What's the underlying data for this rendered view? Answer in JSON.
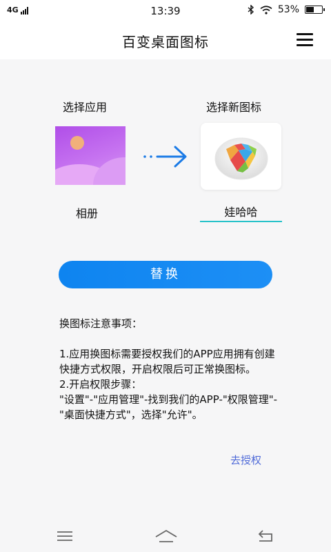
{
  "status": {
    "network": "4G",
    "time": "13:39",
    "battery_text": "53%",
    "battery_level": 0.53
  },
  "appbar": {
    "title": "百变桌面图标",
    "menu_icon": "hamburger-menu-icon"
  },
  "picker": {
    "select_app_label": "选择应用",
    "select_icon_label": "选择新图标",
    "app_name": "相册",
    "new_name_value": "娃哈哈"
  },
  "actions": {
    "replace_label": "替换",
    "go_authorize": "去授权"
  },
  "notes": {
    "heading": "换图标注意事项：",
    "line1": "1.应用换图标需要授权我们的APP应用拥有创建快捷方式权限，开启权限后可正常换图标。",
    "line2": "2.开启权限步骤：",
    "line3": "\"设置\"-\"应用管理\"-找到我们的APP-\"权限管理\"-\"桌面快捷方式\"，选择\"允许\"。"
  },
  "colors": {
    "primary_button": "#1289f2",
    "input_underline": "#27c2c9",
    "link": "#4f6ad8"
  }
}
